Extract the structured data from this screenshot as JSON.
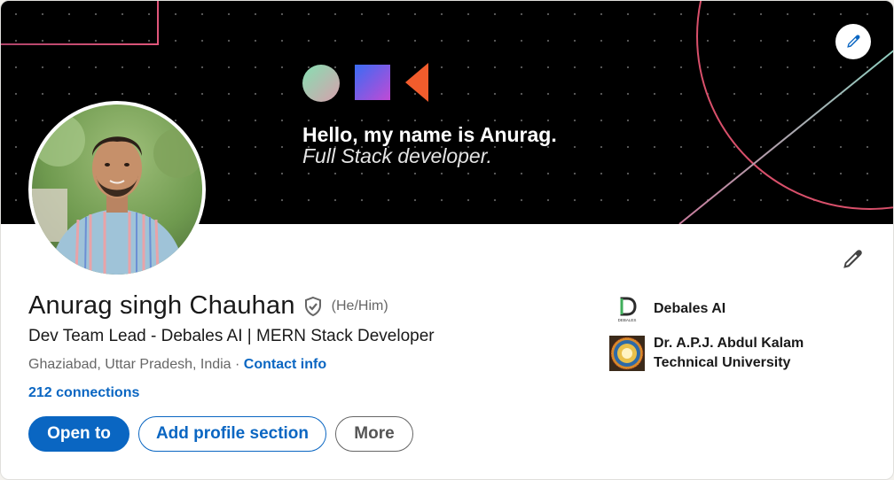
{
  "banner": {
    "greeting": "Hello, my name is Anurag.",
    "role": "Full Stack developer."
  },
  "profile": {
    "name": "Anurag singh Chauhan",
    "pronouns": "(He/Him)",
    "headline": "Dev Team Lead - Debales AI | MERN Stack Developer",
    "location": "Ghaziabad, Uttar Pradesh, India",
    "separator": " · ",
    "contact_label": "Contact info",
    "connections": "212 connections"
  },
  "actions": {
    "open_to": "Open to",
    "add_section": "Add profile section",
    "more": "More"
  },
  "orgs": [
    {
      "name": "Debales AI",
      "logo_text": "DEBALES"
    },
    {
      "name_line1": "Dr. A.P.J. Abdul Kalam",
      "name_line2": "Technical University"
    }
  ],
  "icons": {
    "banner_edit": "pencil-icon",
    "profile_edit": "pencil-icon",
    "verified": "shield-check-icon"
  },
  "colors": {
    "accent": "#0a66c2",
    "banner_bg": "#000000",
    "secondary_text": "#666666"
  }
}
